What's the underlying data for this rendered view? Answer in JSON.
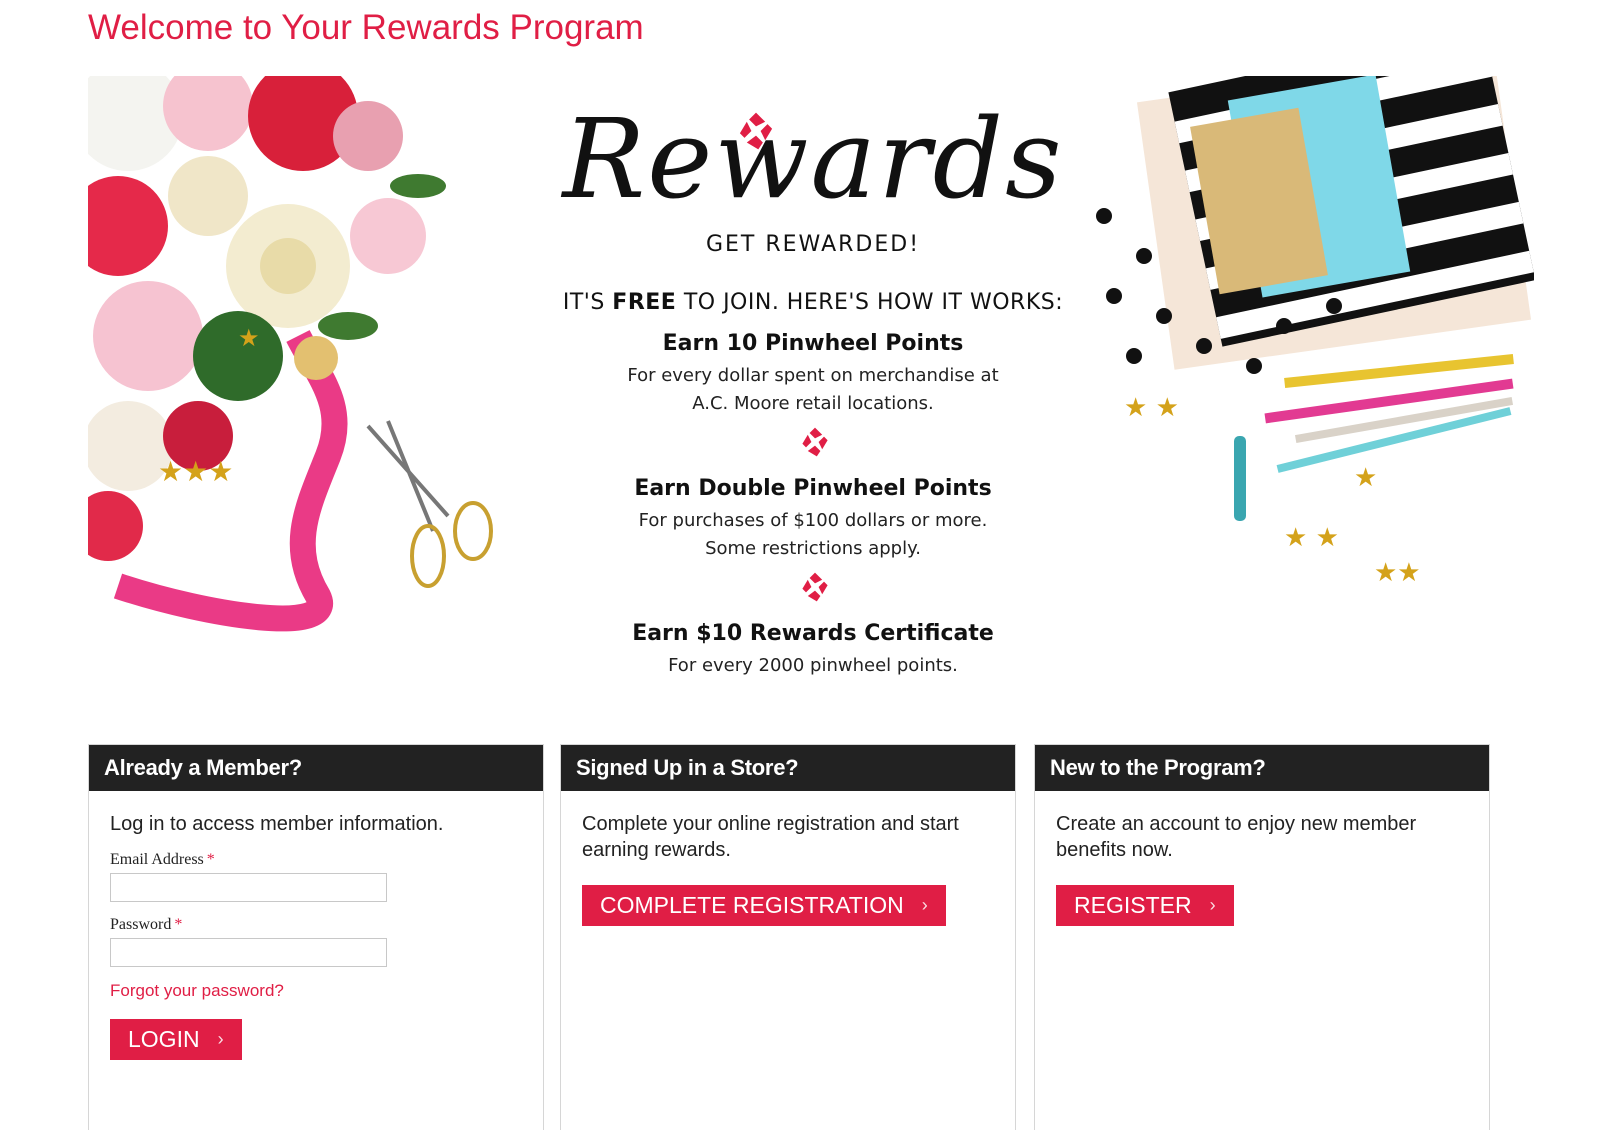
{
  "page": {
    "title": "Welcome to Your Rewards Program"
  },
  "banner": {
    "script_title": "Rewards",
    "tagline": "GET REWARDED!",
    "free_prefix": "IT'S ",
    "free_word": "FREE",
    "free_suffix": " TO JOIN. HERE'S HOW IT WORKS:",
    "steps": [
      {
        "title": "Earn 10 Pinwheel Points",
        "line1": "For every dollar spent on merchandise at",
        "line2": "A.C. Moore retail locations."
      },
      {
        "title": "Earn Double Pinwheel Points",
        "line1": "For purchases of $100 dollars or more.",
        "line2": "Some restrictions apply."
      },
      {
        "title": "Earn $10 Rewards Certificate",
        "line1": "For every 2000 pinwheel points.",
        "line2": ""
      }
    ],
    "icon": "pinwheel-icon"
  },
  "cards": {
    "member": {
      "heading": "Already a Member?",
      "text": "Log in to access member information.",
      "email_label": "Email Address",
      "email_value": "",
      "password_label": "Password",
      "password_value": "",
      "required_mark": "*",
      "forgot_link": "Forgot your password?",
      "login_button": "LOGIN"
    },
    "store": {
      "heading": "Signed Up in a Store?",
      "text": "Complete your online registration and start earning rewards.",
      "button": "COMPLETE REGISTRATION"
    },
    "new": {
      "heading": "New to the Program?",
      "text": "Create an account to enjoy new member benefits now.",
      "button": "REGISTER"
    }
  },
  "button_chevron": "›",
  "colors": {
    "accent": "#e01e45",
    "header_bg": "#222222"
  }
}
